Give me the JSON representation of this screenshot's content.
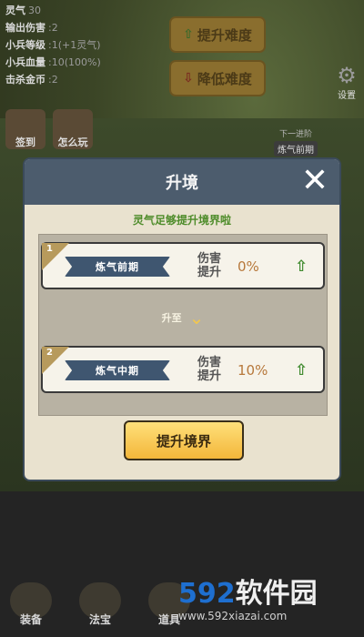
{
  "hud": {
    "stats": [
      {
        "label": "灵气",
        "value": "30"
      },
      {
        "label": "输出伤害",
        "value": ":2"
      },
      {
        "label": "小兵等级",
        "value": ":1(+1灵气)"
      },
      {
        "label": "小兵血量",
        "value": ":10(100%)"
      },
      {
        "label": "击杀金币",
        "value": ":2"
      }
    ],
    "increase_difficulty": "提升难度",
    "decrease_difficulty": "降低难度",
    "settings_label": "设置",
    "signin_label": "签到",
    "howto_label": "怎么玩",
    "realm_progress": "下一进阶",
    "current_realm_tag": "炼气前期"
  },
  "dialog": {
    "title": "升境",
    "hint": "灵气足够提升境界啦",
    "upgrade_to": "升至",
    "button": "提升境界",
    "damage_label": "伤害提升",
    "cards": [
      {
        "rank": "1",
        "realm": "炼气前期",
        "damage_bonus": "0%"
      },
      {
        "rank": "2",
        "realm": "炼气中期",
        "damage_bonus": "10%"
      }
    ]
  },
  "bottom_nav": [
    {
      "label": "装备"
    },
    {
      "label": "法宝"
    },
    {
      "label": "道具"
    }
  ],
  "watermark": {
    "logo_num": "592",
    "logo_cn": "软件园",
    "url": "www.592xiazai.com"
  }
}
